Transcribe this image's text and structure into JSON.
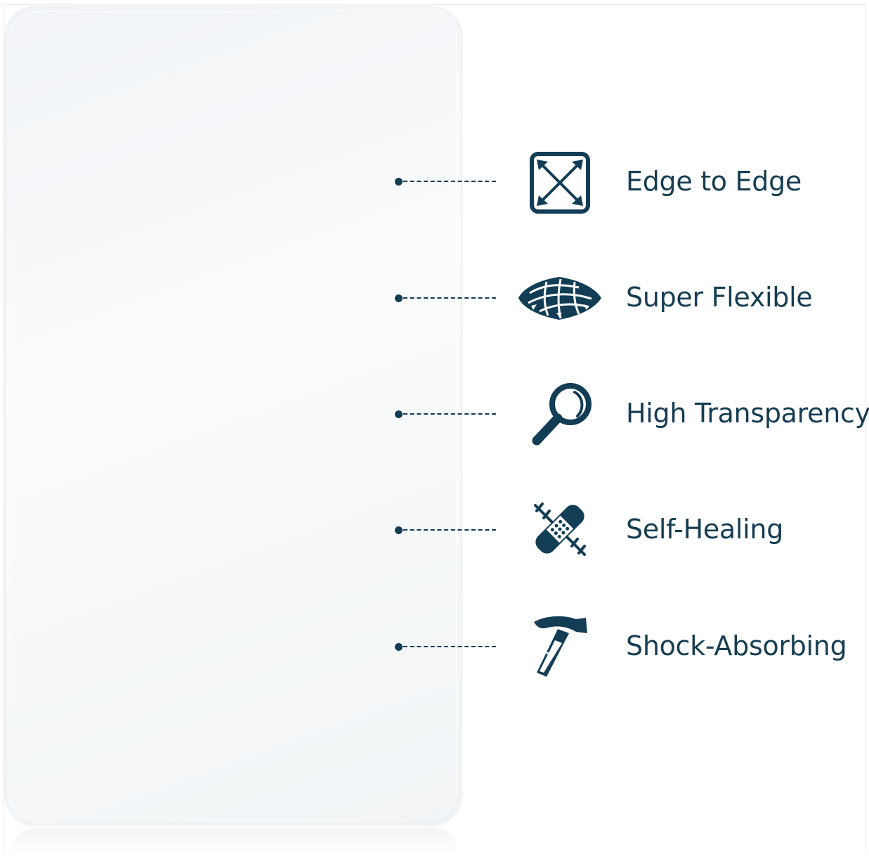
{
  "accent_color": "#123d55",
  "features": [
    {
      "label": "Edge to Edge",
      "icon": "expand-arrows-icon"
    },
    {
      "label": "Super Flexible",
      "icon": "flexible-grid-cushion-icon"
    },
    {
      "label": "High Transparency",
      "icon": "magnifying-glass-icon"
    },
    {
      "label": "Self-Healing",
      "icon": "bandage-icon"
    },
    {
      "label": "Shock-Absorbing",
      "icon": "hammer-icon"
    }
  ]
}
